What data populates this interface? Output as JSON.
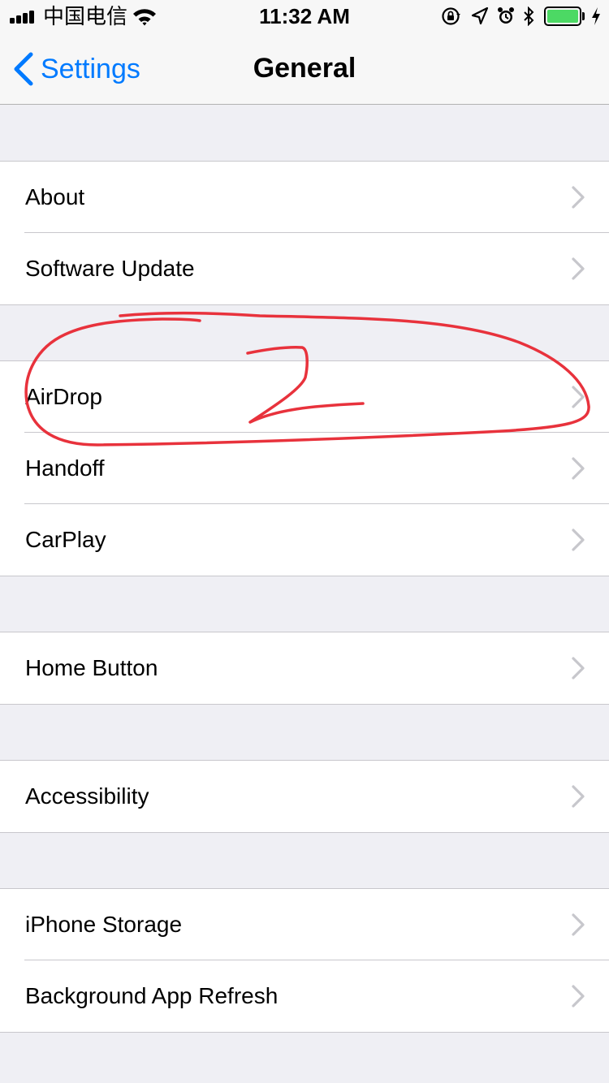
{
  "status_bar": {
    "carrier": "中国电信",
    "time": "11:32 AM",
    "battery_level": 1.0,
    "icons": [
      "signal-icon",
      "wifi-icon",
      "orientation-lock-icon",
      "location-icon",
      "alarm-icon",
      "bluetooth-icon",
      "battery-icon",
      "charging-icon"
    ]
  },
  "nav": {
    "back_label": "Settings",
    "title": "General"
  },
  "groups": [
    {
      "rows": [
        {
          "label": "About"
        },
        {
          "label": "Software Update"
        }
      ]
    },
    {
      "rows": [
        {
          "label": "AirDrop"
        },
        {
          "label": "Handoff"
        },
        {
          "label": "CarPlay"
        }
      ]
    },
    {
      "rows": [
        {
          "label": "Home Button"
        }
      ]
    },
    {
      "rows": [
        {
          "label": "Accessibility"
        }
      ]
    },
    {
      "rows": [
        {
          "label": "iPhone Storage"
        },
        {
          "label": "Background App Refresh"
        }
      ]
    }
  ],
  "colors": {
    "accent": "#007aff",
    "background": "#efeff4",
    "battery": "#4cd964",
    "annotation": "#e8323c",
    "chevron": "#c7c7cc"
  }
}
